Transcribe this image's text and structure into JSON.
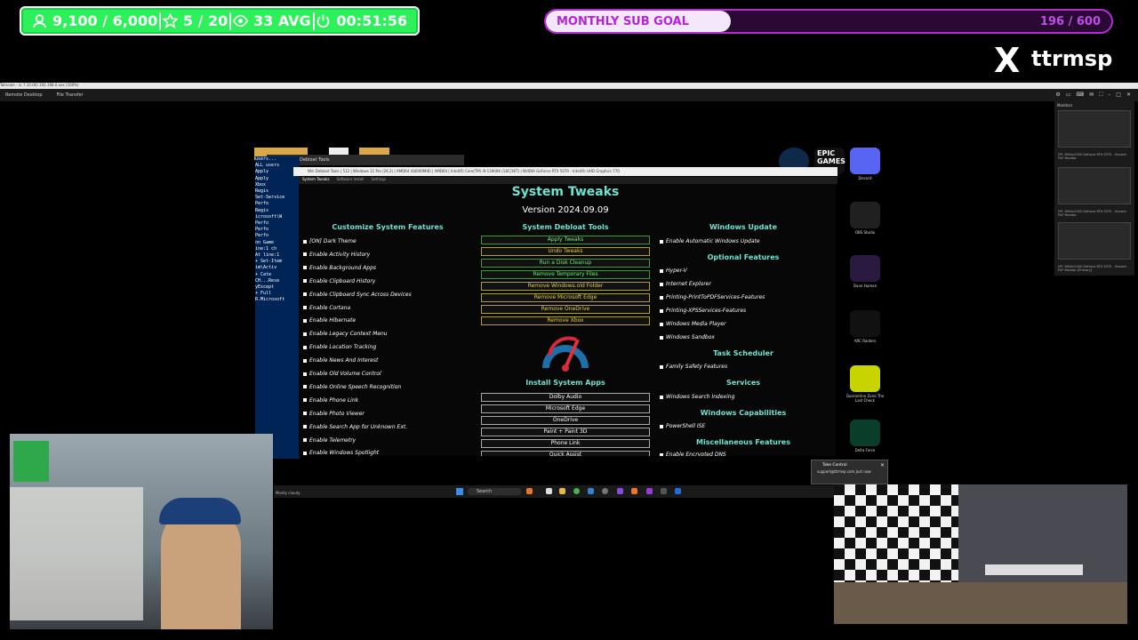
{
  "overlay": {
    "followers": "9,100 / 6,000",
    "stars": "5 / 20",
    "viewers": "33 AVG",
    "uptime": "00:51:56",
    "goal_label": "MONTHLY SUB GOAL",
    "goal_count": "196 / 600",
    "goal_fraction": 0.327,
    "x_logo": "X",
    "handle": "ttrmsp",
    "colors": {
      "stats": "#2ef05a",
      "goal": "#b82ad8"
    }
  },
  "remote": {
    "title": "Tailscale - (v 7.10.00) 192.168.0.xxx (100%)",
    "toolbar_items": [
      "Remote Desktop",
      "File Transfer"
    ],
    "monitors_label": "Monitors",
    "monitors": [
      "DP: 3840x2160 GeForce RTX 5070 - Generic PnP Monitor",
      "DP: 3840x2160 GeForce RTX 5070 - Generic PnP Monitor",
      "DP: 3840x2160 GeForce RTX 5070 - Generic PnP Monitor [Primary]"
    ]
  },
  "desktop_icons": [
    {
      "label": "Discord",
      "color": "#5865f2"
    },
    {
      "label": "OBS Studio",
      "color": "#202020"
    },
    {
      "label": "Dune Human",
      "color": "#2a1a40"
    },
    {
      "label": "ARC Raiders",
      "color": "#111111"
    },
    {
      "label": "Quarantine Zone The Last Check",
      "color": "#c8d400"
    },
    {
      "label": "Delta Force",
      "color": "#0b3d2b"
    }
  ],
  "top_icons": [
    "steam-icon",
    "epic-games-icon"
  ],
  "epic_text": "EPIC GAMES",
  "terminal": {
    "title": "Win Debloat Tools",
    "lines": [
      "users...",
      "ALL users",
      "Apply",
      "Apply",
      "Xbox",
      "Regis",
      "Set-Service",
      "Perfo",
      "Regis",
      "icrosoft\\W",
      "Perfo",
      "Perfo",
      "Perfo",
      "on Game",
      "ine:1 ch",
      "At line:1",
      "+ Set-Item",
      "im\\Activ",
      "+ Cate",
      "CH...Rese",
      "yExcept",
      "+ Full",
      "R.Microsoft"
    ]
  },
  "app": {
    "title": "Win Debloat Tools | 512 | Windows 11 Pro (26.2) | AMD64 (64000MiB) | AMD64 | Intel(R) Core(TM) i9-13900K (18C/36T) | NVIDIA GeForce RTX 5070 - Intel(R) UHD Graphics 770",
    "tabs": [
      "System Tweaks",
      "Software Install",
      "Settings"
    ],
    "heading": "System Tweaks",
    "version": "Version 2024.09.09",
    "left_title": "Customize System Features",
    "left_items": [
      "[ON] Dark Theme",
      "Enable Activity History",
      "Enable Background Apps",
      "Enable Clipboard History",
      "Enable Clipboard Sync Across Devices",
      "Enable Cortana",
      "Enable Hibernate",
      "Enable Legacy Context Menu",
      "Enable Location Tracking",
      "Enable News And Interest",
      "Enable Old Volume Control",
      "Enable Online Speech Recognition",
      "Enable Phone Link",
      "Enable Photo Viewer",
      "Enable Search App for Unknown Ext.",
      "Enable Telemetry",
      "Enable Windows Spotlight"
    ],
    "mid_title": "System Debloat Tools",
    "mid_buttons": [
      {
        "label": "Apply Tweaks",
        "tone": "g"
      },
      {
        "label": "Undo Tweaks",
        "tone": "y"
      },
      {
        "label": "Run a Disk Cleanup",
        "tone": "g"
      },
      {
        "label": "Remove Temporary Files",
        "tone": "g"
      },
      {
        "label": "Remove Windows.old Folder",
        "tone": "y"
      },
      {
        "label": "Remove Microsoft Edge",
        "tone": "y"
      },
      {
        "label": "Remove OneDrive",
        "tone": "y"
      },
      {
        "label": "Remove Xbox",
        "tone": "y"
      }
    ],
    "install_title": "Install System Apps",
    "install_buttons": [
      "Dolby Audio",
      "Microsoft Edge",
      "OneDrive",
      "Paint + Paint 3D",
      "Phone Link",
      "Quick Assist"
    ],
    "right": {
      "windows_update_title": "Windows Update",
      "windows_update_items": [
        "Enable Automatic Windows Update"
      ],
      "optional_title": "Optional Features",
      "optional_items": [
        "Hyper-V",
        "Internet Explorer",
        "Printing-PrintToPDFServices-Features",
        "Printing-XPSServices-Features",
        "Windows Media Player",
        "Windows Sandbox"
      ],
      "task_title": "Task Scheduler",
      "task_items": [
        "Family Safety Features"
      ],
      "services_title": "Services",
      "services_items": [
        "Windows Search Indexing"
      ],
      "capabilities_title": "Windows Capabilities",
      "capabilities_items": [
        "PowerShell ISE"
      ],
      "misc_title": "Miscellaneous Features",
      "misc_items": [
        "Enable Encrypted DNS"
      ]
    }
  },
  "taskbar": {
    "search": "Search",
    "weather": "Mostly cloudy"
  },
  "toast": {
    "title": "Take Control",
    "body": "support@ttrmsp.com Just now"
  }
}
